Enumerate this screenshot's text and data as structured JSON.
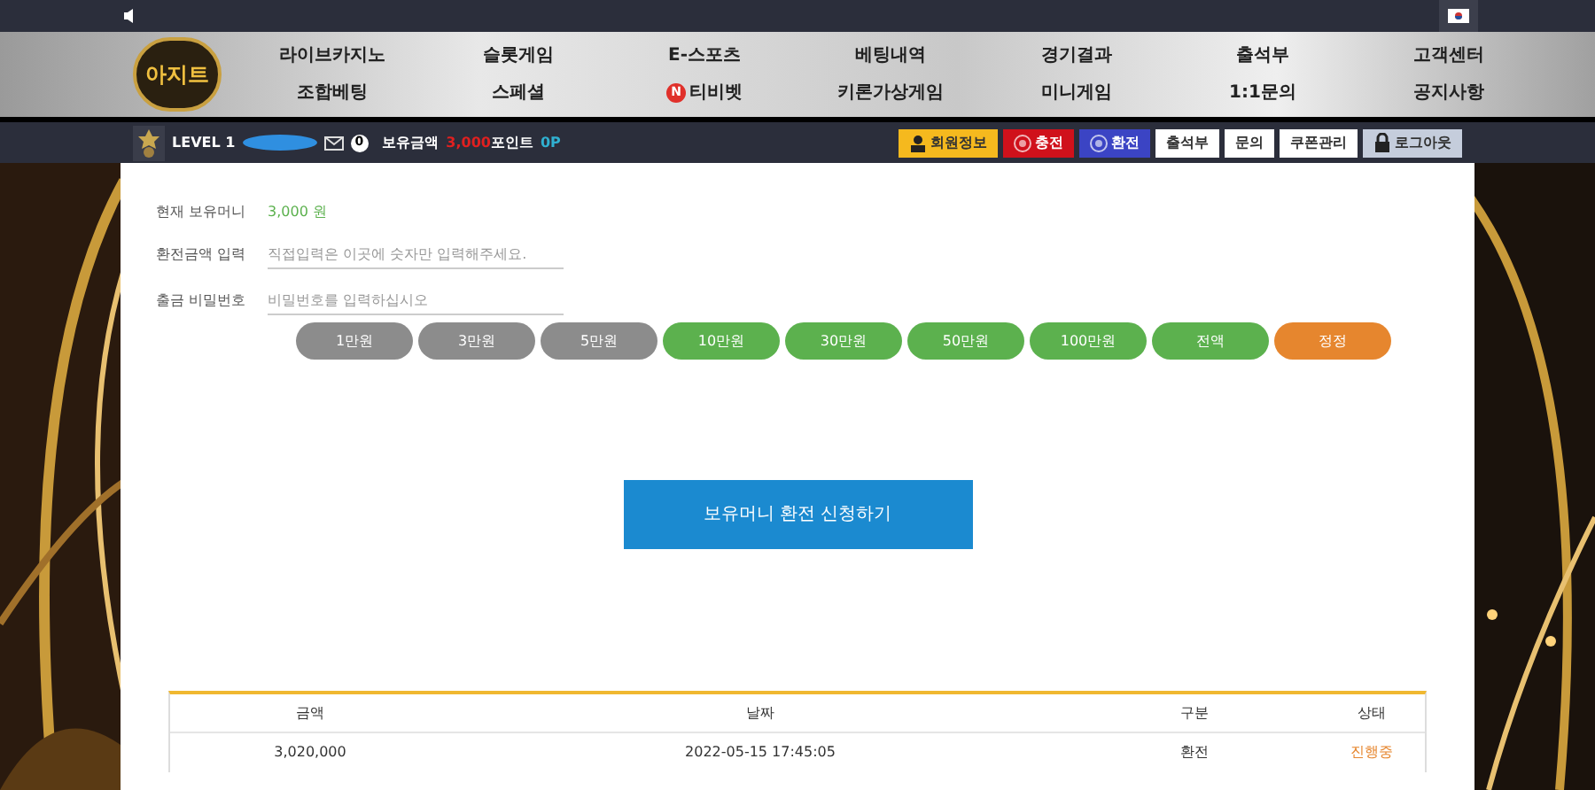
{
  "logo": {
    "text": "아지트"
  },
  "nav": [
    {
      "label": "라이브카지노"
    },
    {
      "label": "슬롯게임"
    },
    {
      "label": "E-스포츠"
    },
    {
      "label": "베팅내역"
    },
    {
      "label": "경기결과"
    },
    {
      "label": "출석부"
    },
    {
      "label": "고객센터"
    },
    {
      "label": "조합베팅"
    },
    {
      "label": "스페셜"
    },
    {
      "label": "티비벳",
      "badge": "N"
    },
    {
      "label": "키론가상게임"
    },
    {
      "label": "미니게임"
    },
    {
      "label": "1:1문의"
    },
    {
      "label": "공지사항"
    }
  ],
  "user_bar": {
    "level": "LEVEL 1",
    "messages": "0",
    "balance_label": "보유금액",
    "balance": "3,000",
    "points_label": "포인트",
    "points": "0P"
  },
  "user_buttons": [
    {
      "label": "회원정보",
      "kind": "person",
      "color": "#f5b91e"
    },
    {
      "label": "충전",
      "kind": "coin",
      "color": "#d0111b"
    },
    {
      "label": "환전",
      "kind": "coin",
      "color": "#3b44c4"
    },
    {
      "label": "출석부",
      "kind": "plain",
      "color": "#ffffff"
    },
    {
      "label": "문의",
      "kind": "plain",
      "color": "#ffffff"
    },
    {
      "label": "쿠폰관리",
      "kind": "plain",
      "color": "#ffffff"
    },
    {
      "label": "로그아웃",
      "kind": "lock",
      "color": "#c5cddc"
    }
  ],
  "form": {
    "balance_label": "현재 보유머니",
    "balance": "3,000 원",
    "amount_label": "환전금액 입력",
    "amount_placeholder": "직접입력은 이곳에 숫자만 입력해주세요.",
    "password_label": "출금 비밀번호",
    "password_placeholder": "비밀번호를 입력하십시오"
  },
  "amount_buttons": [
    {
      "label": "1만원",
      "color": "#8c8c8c"
    },
    {
      "label": "3만원",
      "color": "#8c8c8c"
    },
    {
      "label": "5만원",
      "color": "#8c8c8c"
    },
    {
      "label": "10만원",
      "color": "#5cb14e"
    },
    {
      "label": "30만원",
      "color": "#5cb14e"
    },
    {
      "label": "50만원",
      "color": "#5cb14e"
    },
    {
      "label": "100만원",
      "color": "#5cb14e"
    },
    {
      "label": "전액",
      "color": "#5cb14e"
    },
    {
      "label": "정정",
      "color": "#e6862e"
    }
  ],
  "submit": "보유머니 환전 신청하기",
  "table": {
    "columns": [
      "금액",
      "날짜",
      "구분",
      "상태"
    ],
    "rows": [
      {
        "cells": [
          "3,020,000",
          "2022-05-15 17:45:05",
          "환전",
          "진행중"
        ]
      }
    ]
  }
}
